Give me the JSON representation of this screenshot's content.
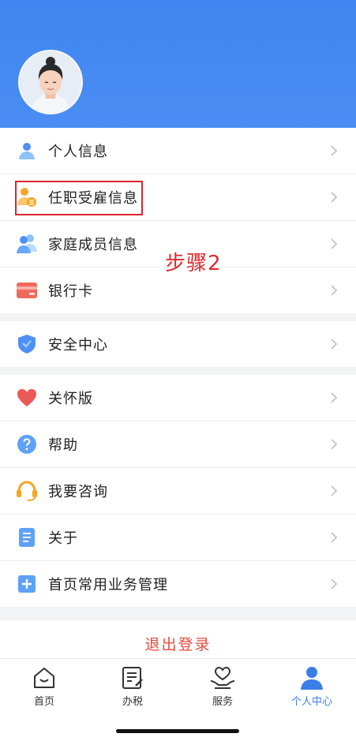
{
  "profile": {
    "avatar_icon": "user-avatar-woman"
  },
  "menu_group1": [
    {
      "label": "个人信息",
      "icon": "person-icon"
    },
    {
      "label": "任职受雇信息",
      "icon": "employment-icon"
    },
    {
      "label": "家庭成员信息",
      "icon": "family-icon"
    },
    {
      "label": "银行卡",
      "icon": "bank-card-icon"
    }
  ],
  "menu_group2": [
    {
      "label": "安全中心",
      "icon": "shield-icon"
    }
  ],
  "menu_group3": [
    {
      "label": "关怀版",
      "icon": "heart-icon"
    },
    {
      "label": "帮助",
      "icon": "help-icon"
    },
    {
      "label": "我要咨询",
      "icon": "headset-icon"
    },
    {
      "label": "关于",
      "icon": "document-icon"
    },
    {
      "label": "首页常用业务管理",
      "icon": "plus-box-icon"
    }
  ],
  "annotation": {
    "step_text": "步骤2"
  },
  "logout": {
    "label": "退出登录"
  },
  "tabbar": [
    {
      "label": "首页",
      "icon": "home-icon",
      "active": false
    },
    {
      "label": "办税",
      "icon": "tax-icon",
      "active": false
    },
    {
      "label": "服务",
      "icon": "service-icon",
      "active": false
    },
    {
      "label": "个人中心",
      "icon": "person-center-icon",
      "active": true
    }
  ],
  "colors": {
    "header_blue": "#4a8df3",
    "accent_red": "#e3282d",
    "tab_active": "#3a7ee8"
  }
}
